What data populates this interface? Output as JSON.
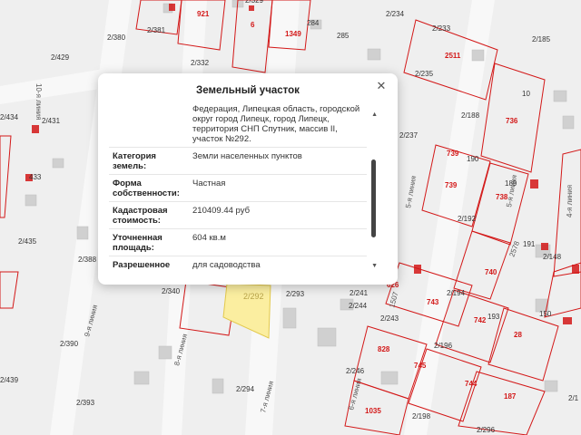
{
  "map": {
    "parcel_labels": [
      "2/380",
      "2/381",
      "921",
      "2/329",
      "6",
      "284",
      "1349",
      "285",
      "2/234",
      "2/233",
      "2/185",
      "10-я линия",
      "2/429",
      "2/332",
      "2511",
      "2/235",
      "2/434",
      "2/431",
      "2/188",
      "736",
      "10",
      "2/237",
      "739",
      "190",
      "189",
      "739",
      "738",
      "2/192",
      "4-я линия",
      "433",
      "191",
      "2/435",
      "2578",
      "740",
      "2/148",
      "2/388",
      "2/436",
      "2/340",
      "2/292",
      "2/293",
      "626",
      "743",
      "2/194",
      "9-я линия",
      "2/244",
      "2/243",
      "742",
      "193",
      "150",
      "2/390",
      "8-я линия",
      "828",
      "2/196",
      "745",
      "2/439",
      "2/246",
      "7-я линия",
      "2/294",
      "744",
      "187",
      "2/393",
      "6-я линия",
      "1035",
      "2/198",
      "2/296",
      "5-я линия",
      "28",
      "1507",
      "2/241",
      "5-я линия",
      "2/1"
    ],
    "highlight_label": "2/292"
  },
  "popup": {
    "title": "Земельный участок",
    "close_icon": "close-icon",
    "address": "Федерация, Липецкая область, городской округ город Липецк, город Липецк, территория СНП Спутник, массив II, участок №292.",
    "rows": [
      {
        "key": "Категория земель:",
        "value": "Земли населенных пунктов"
      },
      {
        "key": "Форма собственности:",
        "value": "Частная"
      },
      {
        "key": "Кадастровая стоимость:",
        "value": "210409.44 руб"
      },
      {
        "key": "Уточненная площадь:",
        "value": "604 кв.м"
      },
      {
        "key": "Разрешенное использование:",
        "value": "для садоводства"
      }
    ]
  },
  "colors": {
    "parcel_border": "#d31818",
    "highlight_fill": "#fbeea0",
    "background": "#eeeeee"
  }
}
